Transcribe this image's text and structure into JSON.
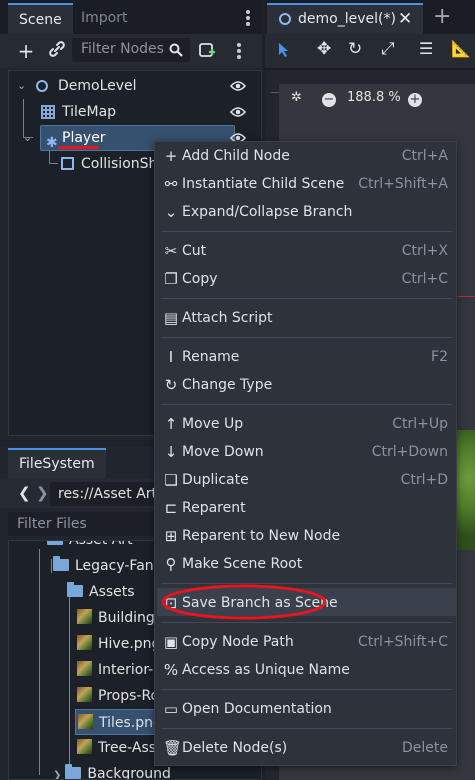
{
  "scene_dock": {
    "tabs": [
      {
        "label": "Scene"
      },
      {
        "label": "Import"
      }
    ],
    "filter_placeholder": "Filter Nodes",
    "tree": [
      {
        "label": "DemoLevel",
        "icon": "node2d-icon"
      },
      {
        "label": "TileMap",
        "icon": "tilemap-icon"
      },
      {
        "label": "Player",
        "icon": "character-icon"
      },
      {
        "label": "CollisionSha",
        "icon": "collision-shape-icon"
      }
    ]
  },
  "editor": {
    "tab_label": "demo_level(*)",
    "zoom_label": "188.8 %"
  },
  "filesystem": {
    "tab_label": "FileSystem",
    "path": "res://Asset Art/",
    "filter_placeholder": "Filter Files",
    "items": [
      {
        "label": "Asset Art",
        "type": "folder"
      },
      {
        "label": "Legacy-Fant",
        "type": "folder"
      },
      {
        "label": "Assets",
        "type": "folder"
      },
      {
        "label": "Buildings",
        "type": "image"
      },
      {
        "label": "Hive.png",
        "type": "image"
      },
      {
        "label": "Interior-C",
        "type": "image"
      },
      {
        "label": "Props-Ro",
        "type": "image"
      },
      {
        "label": "Tiles.png",
        "type": "image"
      },
      {
        "label": "Tree-Ass",
        "type": "image"
      },
      {
        "label": "Background",
        "type": "folder"
      }
    ]
  },
  "context_menu": {
    "groups": [
      [
        {
          "label": "Add Child Node",
          "shortcut": "Ctrl+A",
          "icon": "plus-icon"
        },
        {
          "label": "Instantiate Child Scene",
          "shortcut": "Ctrl+Shift+A",
          "icon": "link-icon"
        },
        {
          "label": "Expand/Collapse Branch",
          "shortcut": "",
          "icon": "chevron-down-icon"
        }
      ],
      [
        {
          "label": "Cut",
          "shortcut": "Ctrl+X",
          "icon": "scissors-icon"
        },
        {
          "label": "Copy",
          "shortcut": "Ctrl+C",
          "icon": "copy-icon"
        }
      ],
      [
        {
          "label": "Attach Script",
          "shortcut": "",
          "icon": "script-add-icon"
        }
      ],
      [
        {
          "label": "Rename",
          "shortcut": "F2",
          "icon": "rename-icon"
        },
        {
          "label": "Change Type",
          "shortcut": "",
          "icon": "refresh-icon"
        }
      ],
      [
        {
          "label": "Move Up",
          "shortcut": "Ctrl+Up",
          "icon": "arrow-up-icon"
        },
        {
          "label": "Move Down",
          "shortcut": "Ctrl+Down",
          "icon": "arrow-down-icon"
        },
        {
          "label": "Duplicate",
          "shortcut": "Ctrl+D",
          "icon": "duplicate-icon"
        },
        {
          "label": "Reparent",
          "shortcut": "",
          "icon": "reparent-icon"
        },
        {
          "label": "Reparent to New Node",
          "shortcut": "",
          "icon": "reparent-new-icon"
        },
        {
          "label": "Make Scene Root",
          "shortcut": "",
          "icon": "scene-root-icon"
        }
      ],
      [
        {
          "label": "Save Branch as Scene",
          "shortcut": "",
          "icon": "save-branch-icon"
        }
      ],
      [
        {
          "label": "Copy Node Path",
          "shortcut": "Ctrl+Shift+C",
          "icon": "node-path-icon"
        },
        {
          "label": "Access as Unique Name",
          "shortcut": "",
          "icon": "percent-icon"
        }
      ],
      [
        {
          "label": "Open Documentation",
          "shortcut": "",
          "icon": "doc-icon"
        }
      ],
      [
        {
          "label": "Delete Node(s)",
          "shortcut": "Delete",
          "icon": "trash-icon"
        }
      ]
    ]
  },
  "colors": {
    "accent": "#4a92e6",
    "annotation_red": "#e8141f",
    "selection": "#36506f"
  }
}
